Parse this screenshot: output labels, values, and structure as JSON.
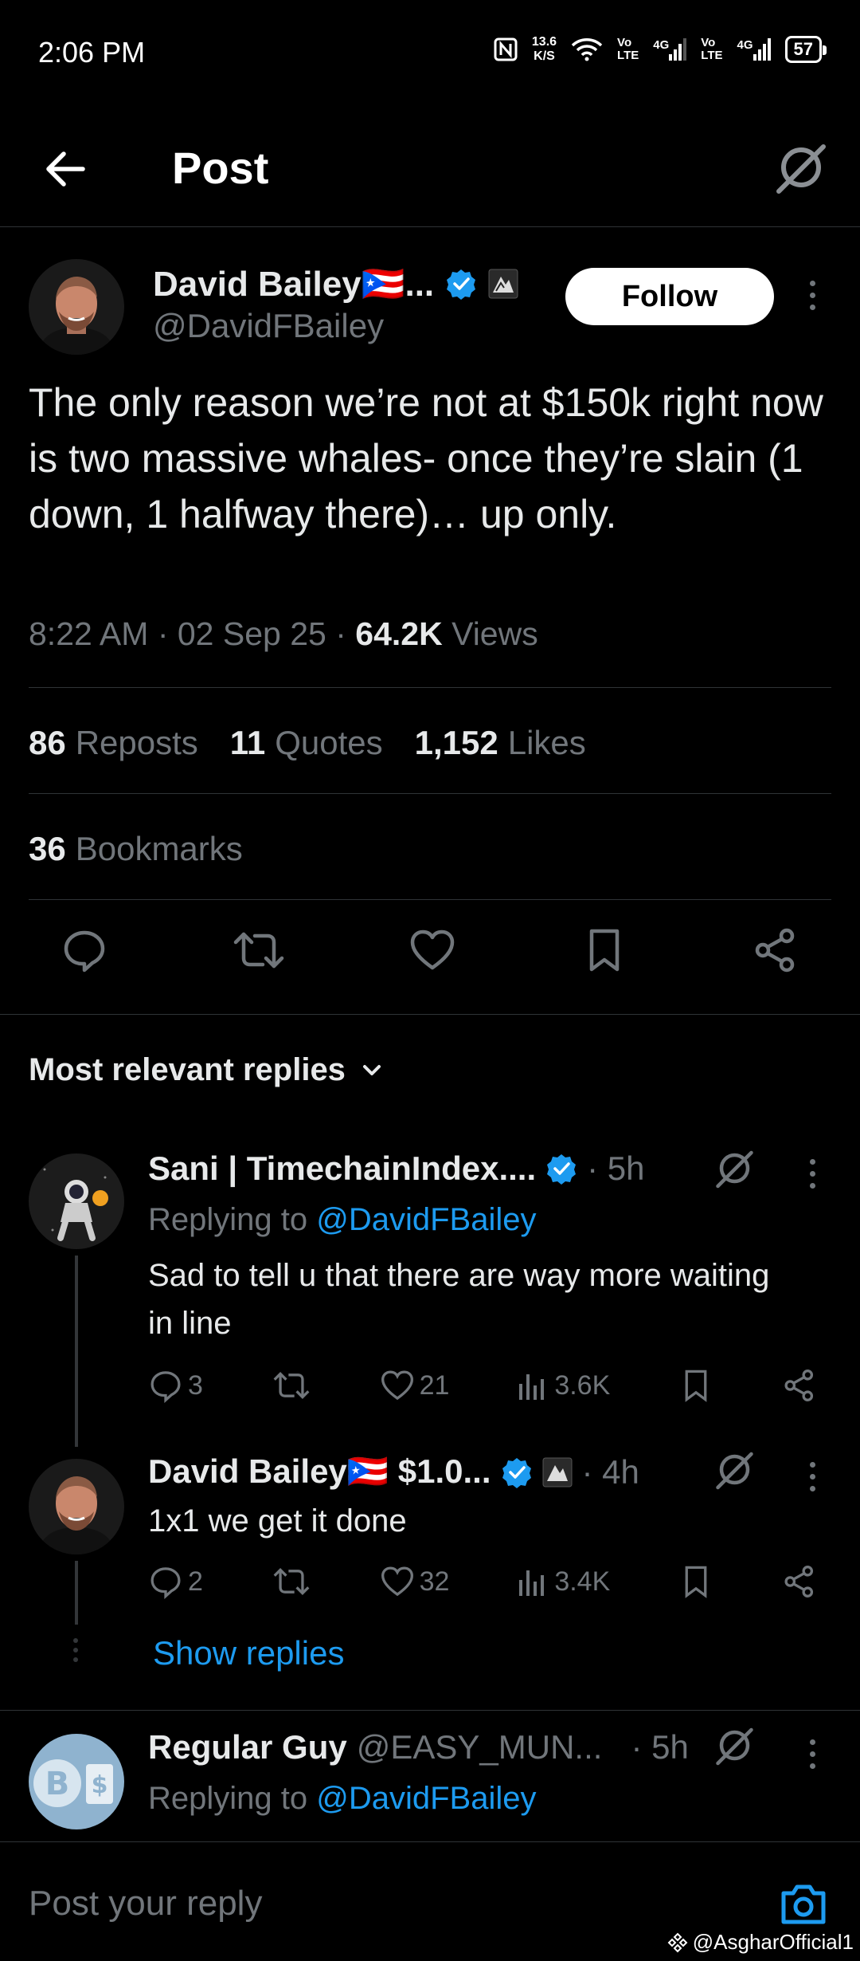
{
  "status_bar": {
    "time": "2:06 PM",
    "net_speed_value": "13.6",
    "net_speed_unit": "K/S",
    "sim1_top": "Vo",
    "sim1_bottom": "LTE",
    "sim1_net": "4G",
    "sim2_top": "Vo",
    "sim2_bottom": "LTE",
    "sim2_net": "4G",
    "battery": "57"
  },
  "header": {
    "title": "Post",
    "icons": [
      "back-arrow-icon",
      "grok-icon"
    ]
  },
  "post": {
    "author_name": "David Bailey🇵🇷...",
    "handle": "@DavidFBailey",
    "follow_label": "Follow",
    "text": "The only reason we’re not at $150k right now is two massive whales- once they’re slain (1 down, 1 halfway there)… up only.",
    "time": "8:22 AM",
    "date": "02 Sep 25",
    "views_count": "64.2K",
    "views_label": "Views",
    "reposts_count": "86",
    "reposts_label": "Reposts",
    "quotes_count": "11",
    "quotes_label": "Quotes",
    "likes_count": "1,152",
    "likes_label": "Likes",
    "bookmarks_count": "36",
    "bookmarks_label": "Bookmarks",
    "action_icons": [
      "reply-icon",
      "repost-icon",
      "like-icon",
      "bookmark-icon",
      "share-icon"
    ]
  },
  "replies_section": {
    "sort_label": "Most relevant replies"
  },
  "replies": [
    {
      "name": "Sani | TimechainIndex....",
      "time": "· 5h",
      "replying_prefix": "Replying to",
      "replying_to": "@DavidFBailey",
      "text": "Sad to tell u that there are way more waiting in line",
      "reply_count": "3",
      "like_count": "21",
      "view_count": "3.6K"
    },
    {
      "name": "David Bailey🇵🇷 $1.0...",
      "time": "· 4h",
      "text": "1x1 we get it done",
      "reply_count": "2",
      "like_count": "32",
      "view_count": "3.4K",
      "show_replies": "Show replies"
    },
    {
      "name": "Regular Guy",
      "handle": "@EASY_MUN...",
      "time": "· 5h",
      "replying_prefix": "Replying to",
      "replying_to": "@DavidFBailey"
    }
  ],
  "compose": {
    "placeholder": "Post your reply"
  },
  "watermark": "@AsgharOfficial1",
  "colors": {
    "background": "#000000",
    "text": "#e7e9ea",
    "muted": "#71767b",
    "accent": "#1d9bf0",
    "divider": "#2f3336"
  }
}
